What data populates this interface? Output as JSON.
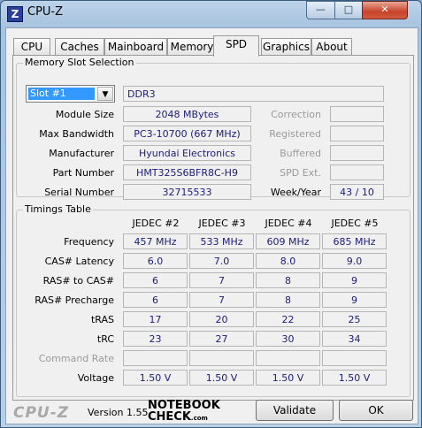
{
  "window": {
    "title": "CPU-Z",
    "app_icon": "Z",
    "minimize_glyph": "—",
    "maximize_glyph": "□",
    "close_glyph": "✕"
  },
  "tabs": [
    {
      "label": "CPU"
    },
    {
      "label": "Caches"
    },
    {
      "label": "Mainboard"
    },
    {
      "label": "Memory"
    },
    {
      "label": "SPD"
    },
    {
      "label": "Graphics"
    },
    {
      "label": "About"
    }
  ],
  "memory_slot": {
    "group_title": "Memory Slot Selection",
    "slot_selected": "Slot #1",
    "type": "DDR3",
    "labels": {
      "module_size": "Module Size",
      "max_bandwidth": "Max Bandwidth",
      "manufacturer": "Manufacturer",
      "part_number": "Part Number",
      "serial_number": "Serial Number",
      "correction": "Correction",
      "registered": "Registered",
      "buffered": "Buffered",
      "spd_ext": "SPD Ext.",
      "week_year": "Week/Year"
    },
    "values": {
      "module_size": "2048 MBytes",
      "max_bandwidth": "PC3-10700 (667 MHz)",
      "manufacturer": "Hyundai Electronics",
      "part_number": "HMT325S6BFR8C-H9",
      "serial_number": "32715533",
      "correction": "",
      "registered": "",
      "buffered": "",
      "spd_ext": "",
      "week_year": "43 / 10"
    }
  },
  "timings": {
    "group_title": "Timings Table",
    "columns": [
      "JEDEC #2",
      "JEDEC #3",
      "JEDEC #4",
      "JEDEC #5"
    ],
    "rows": [
      {
        "label": "Frequency",
        "disabled": false,
        "values": [
          "457 MHz",
          "533 MHz",
          "609 MHz",
          "685 MHz"
        ]
      },
      {
        "label": "CAS# Latency",
        "disabled": false,
        "values": [
          "6.0",
          "7.0",
          "8.0",
          "9.0"
        ]
      },
      {
        "label": "RAS# to CAS#",
        "disabled": false,
        "values": [
          "6",
          "7",
          "8",
          "9"
        ]
      },
      {
        "label": "RAS# Precharge",
        "disabled": false,
        "values": [
          "6",
          "7",
          "8",
          "9"
        ]
      },
      {
        "label": "tRAS",
        "disabled": false,
        "values": [
          "17",
          "20",
          "22",
          "25"
        ]
      },
      {
        "label": "tRC",
        "disabled": false,
        "values": [
          "23",
          "27",
          "30",
          "34"
        ]
      },
      {
        "label": "Command Rate",
        "disabled": true,
        "values": [
          "",
          "",
          "",
          ""
        ]
      },
      {
        "label": "Voltage",
        "disabled": false,
        "values": [
          "1.50 V",
          "1.50 V",
          "1.50 V",
          "1.50 V"
        ]
      }
    ]
  },
  "footer": {
    "logo": "CPU-Z",
    "version": "Version 1.55",
    "watermark_line1": "NOTEBOOK",
    "watermark_line2": "CHECK",
    "watermark_suffix": ".com",
    "validate_label": "Validate",
    "ok_label": "OK"
  }
}
